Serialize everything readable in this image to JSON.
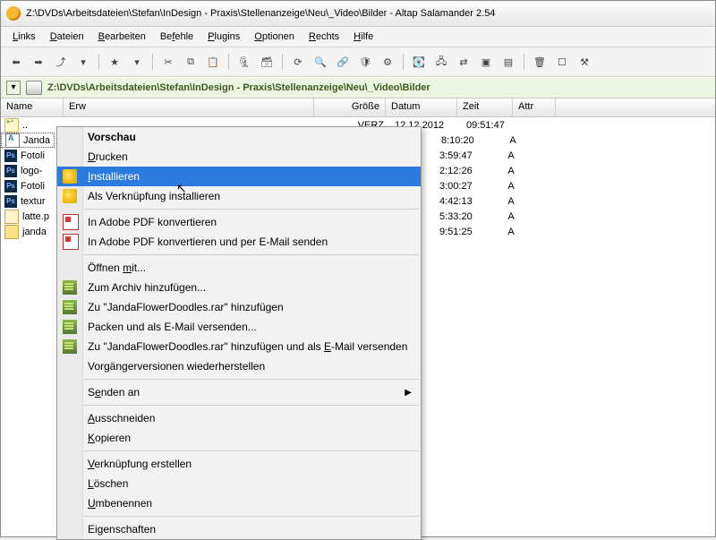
{
  "window_title": "Z:\\DVDs\\Arbeitsdateien\\Stefan\\InDesign - Praxis\\Stellenanzeige\\Neu\\_Video\\Bilder - Altap Salamander 2.54",
  "menu": {
    "links": "Links",
    "dateien": "Dateien",
    "bearbeiten": "Bearbeiten",
    "befehle": "Befehle",
    "plugins": "Plugins",
    "optionen": "Optionen",
    "rechts": "Rechts",
    "hilfe": "Hilfe"
  },
  "path": "Z:\\DVDs\\Arbeitsdateien\\Stefan\\InDesign - Praxis\\Stellenanzeige\\Neu\\_Video\\Bilder",
  "columns": {
    "name": "Name",
    "ext": "Erw",
    "size": "Größe",
    "date": "Datum",
    "time": "Zeit",
    "attr": "Attr"
  },
  "updir": {
    "size": "VERZ",
    "date": "12.12.2012",
    "time": "09:51:47"
  },
  "files": [
    {
      "name": "Janda",
      "icon": "font",
      "time": "8:10:20",
      "attr": "A"
    },
    {
      "name": "Fotoli",
      "icon": "ps",
      "time": "3:59:47",
      "attr": "A"
    },
    {
      "name": "logo-",
      "icon": "ps",
      "time": "2:12:26",
      "attr": "A"
    },
    {
      "name": "Fotoli",
      "icon": "ps",
      "time": "3:00:27",
      "attr": "A"
    },
    {
      "name": "textur",
      "icon": "ps",
      "time": "4:42:13",
      "attr": "A"
    },
    {
      "name": "latte.p",
      "icon": "jpg",
      "time": "5:33:20",
      "attr": "A"
    },
    {
      "name": "janda",
      "icon": "folder",
      "time": "9:51:25",
      "attr": "A"
    }
  ],
  "ctx": {
    "vorschau": "Vorschau",
    "drucken": "Drucken",
    "installieren": "Installieren",
    "als_verk": "Als Verknüpfung installieren",
    "pdf_konv": "In Adobe PDF konvertieren",
    "pdf_mail": "In Adobe PDF konvertieren und per E-Mail senden",
    "oeffnen_mit": "Öffnen mit...",
    "zum_archiv": "Zum Archiv hinzufügen...",
    "zu_rar": "Zu \"JandaFlowerDoodles.rar\" hinzufügen",
    "packen_mail": "Packen und als E-Mail versenden...",
    "zu_rar_mail": "Zu \"JandaFlowerDoodles.rar\" hinzufügen und als E-Mail versenden",
    "vorgaenger": "Vorgängerversionen wiederherstellen",
    "senden_an": "Senden an",
    "ausschneiden": "Ausschneiden",
    "kopieren": "Kopieren",
    "verknuepfung": "Verknüpfung erstellen",
    "loeschen": "Löschen",
    "umbenennen": "Umbenennen",
    "eigenschaften": "Eigenschaften"
  }
}
